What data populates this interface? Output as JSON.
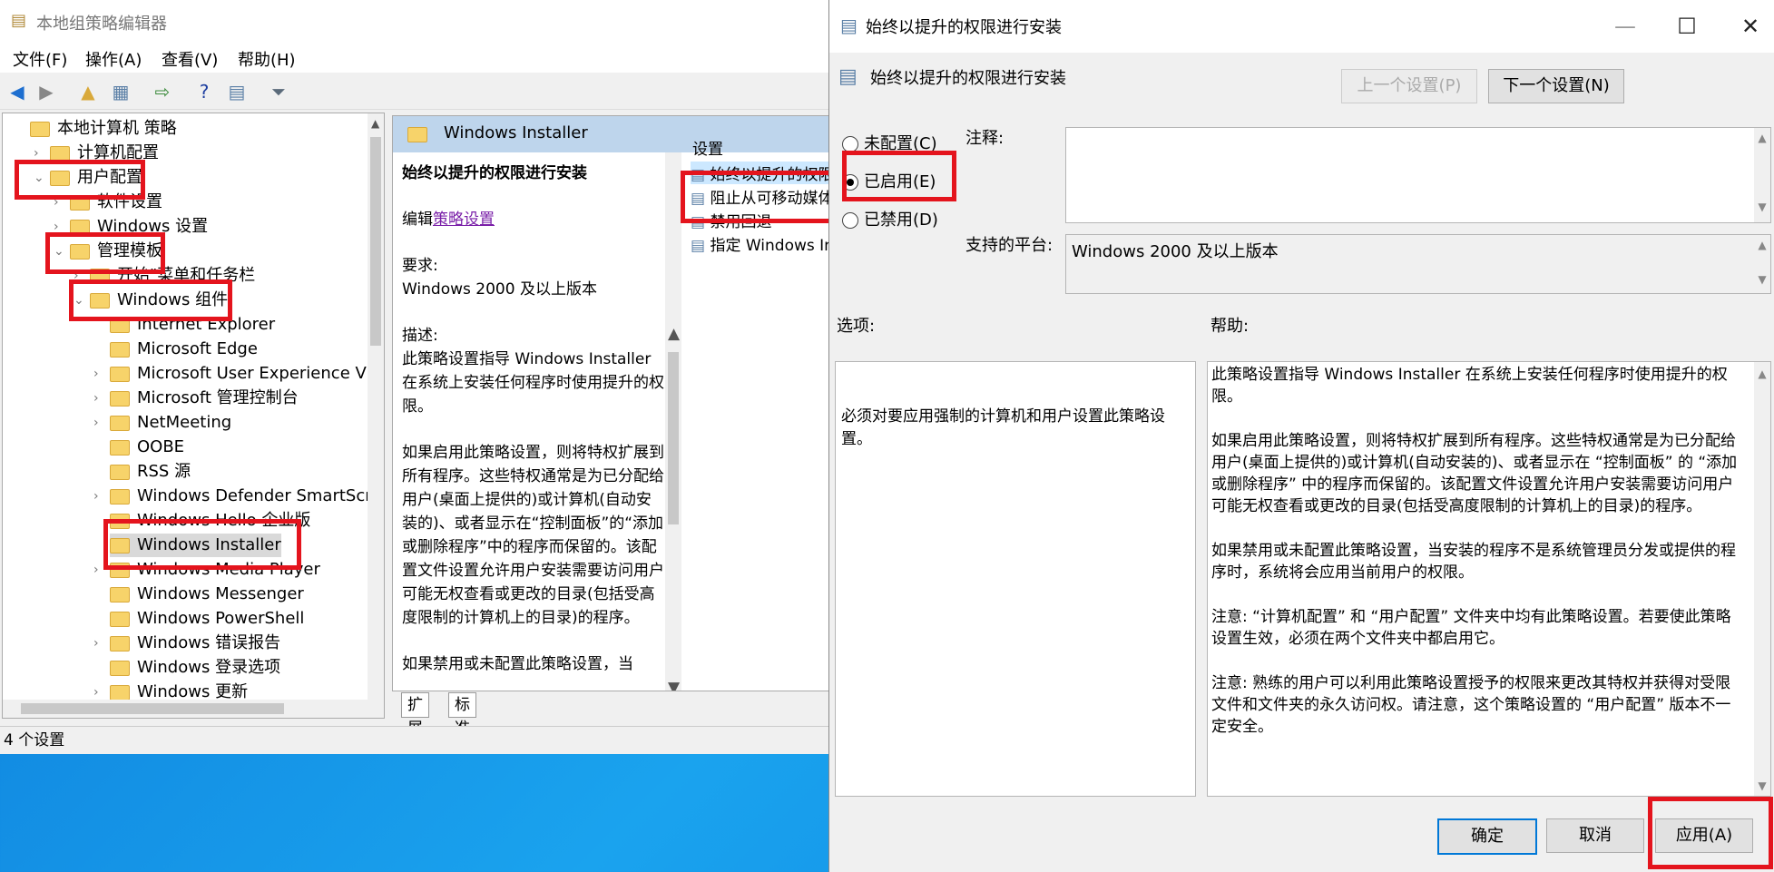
{
  "editor": {
    "title": "本地组策略编辑器",
    "menu": [
      "文件(F)",
      "操作(A)",
      "查看(V)",
      "帮助(H)"
    ],
    "tree": [
      {
        "label": "本地计算机 策略",
        "indent": 0
      },
      {
        "label": "计算机配置",
        "indent": 1
      },
      {
        "label": "用户配置",
        "indent": 1
      },
      {
        "label": "软件设置",
        "indent": 2
      },
      {
        "label": "Windows 设置",
        "indent": 2
      },
      {
        "label": "管理模板",
        "indent": 2
      },
      {
        "label": "开始\"菜单和任务栏",
        "indent": 3
      },
      {
        "label": "Windows 组件",
        "indent": 3
      },
      {
        "label": "Internet Explorer",
        "indent": 4
      },
      {
        "label": "Microsoft Edge",
        "indent": 4
      },
      {
        "label": "Microsoft User Experience Virt",
        "indent": 4
      },
      {
        "label": "Microsoft 管理控制台",
        "indent": 4
      },
      {
        "label": "NetMeeting",
        "indent": 4
      },
      {
        "label": "OOBE",
        "indent": 4
      },
      {
        "label": "RSS 源",
        "indent": 4
      },
      {
        "label": "Windows Defender SmartScre",
        "indent": 4
      },
      {
        "label": "Windows Hello 企业版",
        "indent": 4
      },
      {
        "label": "Windows Installer",
        "indent": 4
      },
      {
        "label": "Windows Media Player",
        "indent": 4
      },
      {
        "label": "Windows Messenger",
        "indent": 4
      },
      {
        "label": "Windows PowerShell",
        "indent": 4
      },
      {
        "label": "Windows 错误报告",
        "indent": 4
      },
      {
        "label": "Windows 登录选项",
        "indent": 4
      },
      {
        "label": "Windows 更新",
        "indent": 4
      }
    ],
    "folder_header": "Windows Installer",
    "description": {
      "title": "始终以提升的权限进行安装",
      "edit_prefix": "编辑",
      "edit_link": "策略设置",
      "req_label": "要求:",
      "req_value": "Windows 2000 及以上版本",
      "desc_label": "描述:",
      "p1": "此策略设置指导 Windows Installer 在系统上安装任何程序时使用提升的权限。",
      "p2": "如果启用此策略设置，则将特权扩展到所有程序。这些特权通常是为已分配给用户(桌面上提供的)或计算机(自动安装的)、或者显示在“控制面板”的“添加或删除程序”中的程序而保留的。该配置文件设置允许用户安装需要访问用户可能无权查看或更改的目录(包括受高度限制的计算机上的目录)的程序。",
      "p3": "如果禁用或未配置此策略设置，当"
    },
    "settings_header": "设置",
    "settings": [
      "始终以提升的权限进行安装",
      "阻止从可移动媒体进行任何安装",
      "禁用回退",
      "指定 Windows Installer"
    ],
    "tabs": [
      "扩展",
      "标准"
    ],
    "status": "4 个设置"
  },
  "dialog": {
    "title": "始终以提升的权限进行安装",
    "header_title": "始终以提升的权限进行安装",
    "prev_button": "上一个设置(P)",
    "next_button": "下一个设置(N)",
    "radios": [
      "未配置(C)",
      "已启用(E)",
      "已禁用(D)"
    ],
    "selected_radio": "已启用(E)",
    "comment_label": "注释:",
    "comment_value": "",
    "platform_label": "支持的平台:",
    "platform_value": "Windows 2000 及以上版本",
    "options_label": "选项:",
    "help_label": "帮助:",
    "options_text": "必须对要应用强制的计算机和用户设置此策略设置。",
    "help": [
      "此策略设置指导 Windows Installer 在系统上安装任何程序时使用提升的权限。",
      "如果启用此策略设置，则将特权扩展到所有程序。这些特权通常是为已分配给用户(桌面上提供的)或计算机(自动安装的)、或者显示在 “控制面板” 的 “添加或删除程序” 中的程序而保留的。该配置文件设置允许用户安装需要访问用户可能无权查看或更改的目录(包括受高度限制的计算机上的目录)的程序。",
      "如果禁用或未配置此策略设置，当安装的程序不是系统管理员分发或提供的程序时，系统将会应用当前用户的权限。",
      "注意: “计算机配置” 和 “用户配置” 文件夹中均有此策略设置。若要使此策略设置生效，必须在两个文件夹中都启用它。",
      "注意: 熟练的用户可以利用此策略设置授予的权限来更改其特权并获得对受限文件和文件夹的永久访问权。请注意，这个策略设置的 “用户配置” 版本不一定安全。"
    ],
    "ok_button": "确定",
    "cancel_button": "取消",
    "apply_button": "应用(A)"
  },
  "colors": {
    "highlight": "#e4141d",
    "accent": "#0078d7"
  }
}
